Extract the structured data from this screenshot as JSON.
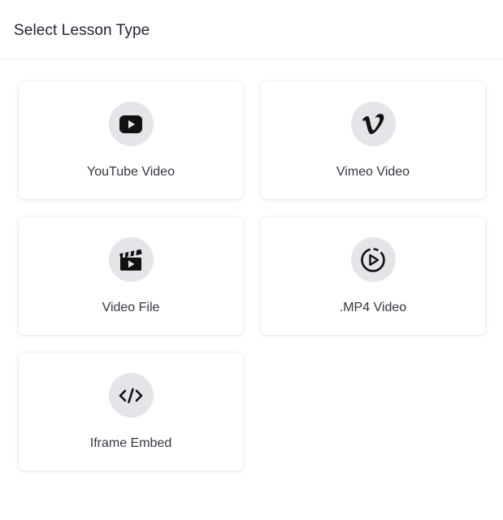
{
  "dialog": {
    "title": "Select Lesson Type"
  },
  "lesson_types": [
    {
      "label": "YouTube Video",
      "icon": "youtube-icon"
    },
    {
      "label": "Vimeo Video",
      "icon": "vimeo-icon"
    },
    {
      "label": "Video File",
      "icon": "clapperboard-icon"
    },
    {
      "label": ".MP4 Video",
      "icon": "play-circle-icon"
    },
    {
      "label": "Iframe Embed",
      "icon": "code-icon"
    }
  ],
  "colors": {
    "icon_bg": "#e4e5e9",
    "icon_fg": "#111111",
    "text": "#33363f",
    "title": "#1f2233"
  }
}
